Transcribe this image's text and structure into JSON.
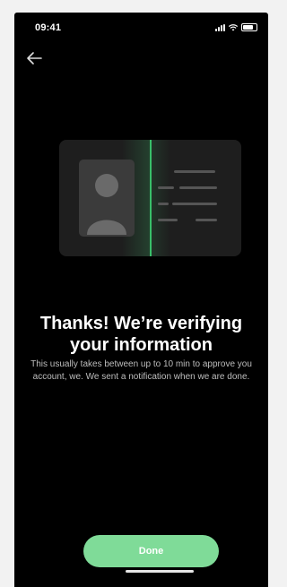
{
  "status_bar": {
    "time": "09:41"
  },
  "header": {
    "back_icon": "arrow-left-icon"
  },
  "illustration": {
    "icon": "id-card-scan-icon",
    "accent": "#3fe07a"
  },
  "content": {
    "title_line1": "Thanks! We’re verifying",
    "title_line2": "your information",
    "description": "This usually takes between up to 10 min to approve you account, we. We sent a notification when we are done."
  },
  "actions": {
    "done_label": "Done",
    "done_color": "#7fdb98"
  }
}
